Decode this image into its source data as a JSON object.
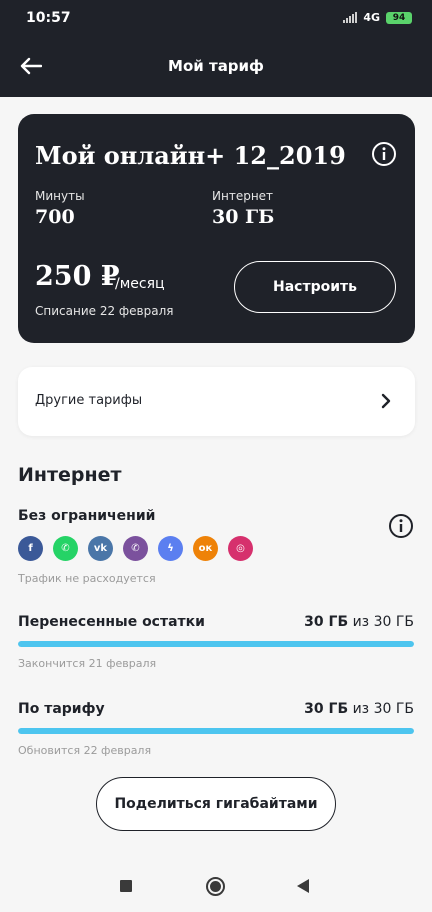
{
  "status_bar": {
    "time": "10:57",
    "network": "4G",
    "battery": "94"
  },
  "header": {
    "title": "Мой тариф"
  },
  "tariff": {
    "name": "Мой онлайн+ 12_2019",
    "minutes_label": "Минуты",
    "minutes_value": "700",
    "internet_label": "Интернет",
    "internet_value": "30 ГБ",
    "price": "250 ₽",
    "price_unit": "/месяц",
    "charge_date": "Списание 22 февраля",
    "configure_label": "Настроить"
  },
  "other_tariffs": {
    "label": "Другие тарифы"
  },
  "internet": {
    "title": "Интернет",
    "unlimited_title": "Без ограничений",
    "apps": [
      {
        "icon": "facebook-icon",
        "glyph": "f",
        "color": "#3b5998"
      },
      {
        "icon": "whatsapp-icon",
        "glyph": "✆",
        "color": "#25d366"
      },
      {
        "icon": "vk-icon",
        "glyph": "vk",
        "color": "#4a76a8"
      },
      {
        "icon": "viber-icon",
        "glyph": "✆",
        "color": "#7b519d"
      },
      {
        "icon": "messenger-icon",
        "glyph": "ϟ",
        "color": "#5b7ff0"
      },
      {
        "icon": "odnoklassniki-icon",
        "glyph": "ок",
        "color": "#ee8208"
      },
      {
        "icon": "instagram-icon",
        "glyph": "◎",
        "color": "#d6306d"
      }
    ],
    "traffic_note": "Трафик не расходуется",
    "rollover": {
      "title": "Перенесенные остатки",
      "used": "30 ГБ",
      "separator": "из",
      "total": "30 ГБ",
      "fraction": 1.0,
      "note": "Закончится 21 февраля"
    },
    "plan": {
      "title": "По тарифу",
      "used": "30 ГБ",
      "separator": "из",
      "total": "30 ГБ",
      "fraction": 1.0,
      "note": "Обновится 22 февраля"
    },
    "share_label": "Поделиться гигабайтами"
  },
  "colors": {
    "dark": "#1f2229",
    "accent": "#4dc5ef"
  }
}
